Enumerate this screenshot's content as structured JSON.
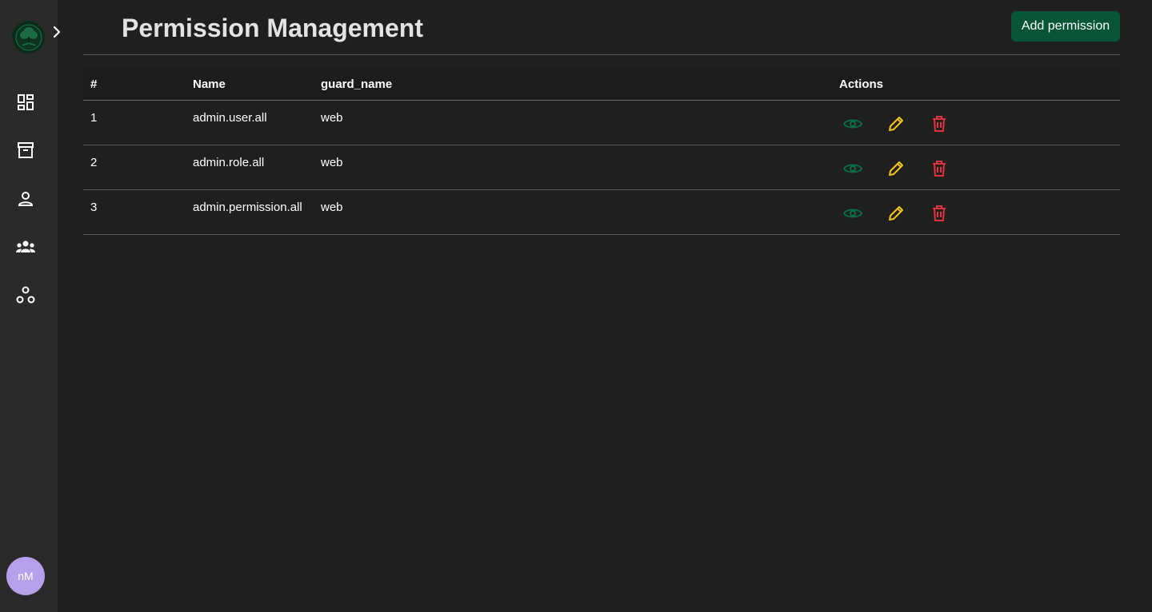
{
  "page": {
    "title": "Permission Management",
    "add_button_label": "Add permission"
  },
  "sidebar": {
    "avatar_initials": "nM",
    "items": [
      {
        "icon": "dashboard-icon"
      },
      {
        "icon": "archive-icon"
      },
      {
        "icon": "user-icon"
      },
      {
        "icon": "group-icon"
      },
      {
        "icon": "hierarchy-icon"
      }
    ]
  },
  "table": {
    "columns": {
      "index": "#",
      "name": "Name",
      "guard_name": "guard_name",
      "actions": "Actions"
    },
    "rows": [
      {
        "index": "1",
        "name": "admin.user.all",
        "guard_name": "web"
      },
      {
        "index": "2",
        "name": "admin.role.all",
        "guard_name": "web"
      },
      {
        "index": "3",
        "name": "admin.permission.all",
        "guard_name": "web"
      }
    ]
  },
  "colors": {
    "accent": "#055536",
    "view": "#0a6b45",
    "edit": "#f5c518",
    "delete": "#e5333d",
    "avatar": "#b7a0ea"
  }
}
